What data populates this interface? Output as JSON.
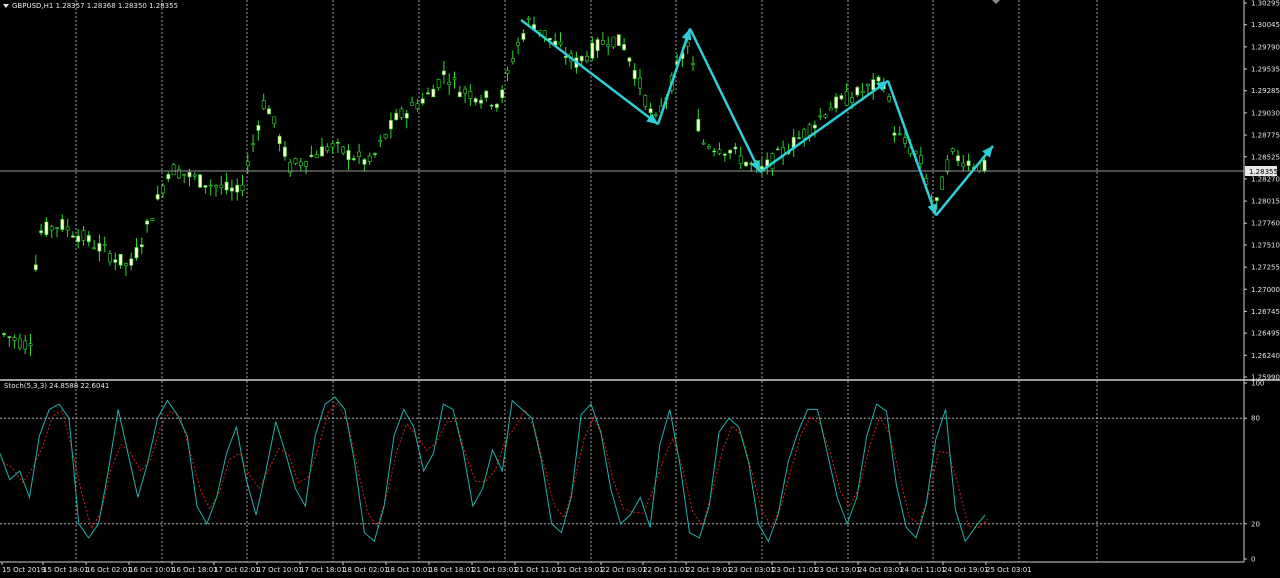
{
  "main_chart": {
    "symbol_label": "GBPUSD,H1  1.28357 1.28368 1.28350 1.28355",
    "current_price_label": "1.28355",
    "price_ticks": [
      "1.30295",
      "1.30045",
      "1.29790",
      "1.29535",
      "1.29285",
      "1.29030",
      "1.28775",
      "1.28525",
      "1.28270",
      "1.28015",
      "1.27760",
      "1.27510",
      "1.27255",
      "1.27000",
      "1.26745",
      "1.26495",
      "1.26240",
      "1.25990"
    ]
  },
  "oscillator": {
    "label": "Stoch(5,3,3) 24.8588 22.6041",
    "scale_ticks": [
      "100",
      "80",
      "20",
      "0"
    ],
    "levels": [
      80,
      20
    ]
  },
  "time_axis": {
    "labels": [
      "15 Oct 2019",
      "15 Oct 18:01",
      "16 Oct 02:01",
      "16 Oct 10:01",
      "16 Oct 18:01",
      "17 Oct 02:01",
      "17 Oct 10:01",
      "17 Oct 18:01",
      "18 Oct 02:01",
      "18 Oct 10:01",
      "18 Oct 18:01",
      "21 Oct 03:01",
      "21 Oct 11:01",
      "21 Oct 19:01",
      "22 Oct 03:01",
      "22 Oct 11:01",
      "22 Oct 19:01",
      "23 Oct 03:01",
      "23 Oct 11:01",
      "23 Oct 19:01",
      "24 Oct 03:01",
      "24 Oct 11:01",
      "24 Oct 19:01",
      "25 Oct 03:01"
    ]
  },
  "colors": {
    "background": "#000000",
    "bull_candle": "#ffffd0",
    "bear_candle": "#000000",
    "wick": "#2fd82f",
    "grid": "#c8c8c8",
    "zigzag_arrow": "#2ecfd8",
    "stoch_main": "#20b2aa",
    "stoch_signal": "#cc2222"
  },
  "chart_data": {
    "type": "line",
    "zigzag_points": [
      {
        "x": "21 Oct 10:00",
        "y": 1.301
      },
      {
        "x": "22 Oct 07:00",
        "y": 1.289
      },
      {
        "x": "22 Oct 13:00",
        "y": 1.3
      },
      {
        "x": "23 Oct 04:00",
        "y": 1.2835
      },
      {
        "x": "24 Oct 01:00",
        "y": 1.294
      },
      {
        "x": "24 Oct 12:00",
        "y": 1.2785
      },
      {
        "x": "25 Oct 05:00",
        "y": 1.2865
      }
    ],
    "stochastic_levels": [
      80,
      20
    ]
  }
}
